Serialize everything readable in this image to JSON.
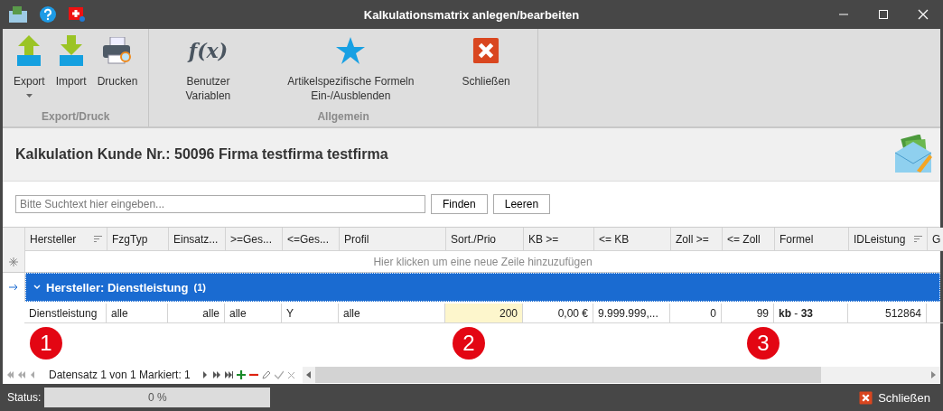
{
  "window": {
    "title": "Kalkulationsmatrix anlegen/bearbeiten"
  },
  "ribbon": {
    "groups": [
      {
        "label": "Export/Druck",
        "buttons": [
          {
            "kind": "export",
            "label": "Export",
            "dropdown": true
          },
          {
            "kind": "import",
            "label": "Import",
            "dropdown": false
          },
          {
            "kind": "print",
            "label": "Drucken",
            "dropdown": false
          }
        ]
      },
      {
        "label": "Allgemein",
        "buttons": [
          {
            "kind": "formula",
            "label": "Benutzer Variablen",
            "icon_text": "f(x)",
            "dropdown": false
          },
          {
            "kind": "star",
            "label": "Artikelspezifische Formeln Ein-/Ausblenden",
            "dropdown": false
          },
          {
            "kind": "close",
            "label": "Schließen",
            "dropdown": false
          }
        ]
      }
    ]
  },
  "header": {
    "title": "Kalkulation Kunde Nr.: 50096 Firma testfirma testfirma"
  },
  "search": {
    "placeholder": "Bitte Suchtext hier eingeben...",
    "buttons": [
      "Finden",
      "Leeren"
    ]
  },
  "grid": {
    "columns": [
      {
        "label": "Hersteller",
        "sorted": true,
        "kind": "text"
      },
      {
        "label": "FzgTyp",
        "sorted": false,
        "kind": "text"
      },
      {
        "label": "Einsatz...",
        "sorted": false,
        "kind": "number"
      },
      {
        "label": ">=Ges...",
        "sorted": false,
        "kind": "text"
      },
      {
        "label": "<=Ges...",
        "sorted": false,
        "kind": "text"
      },
      {
        "label": "Profil",
        "sorted": false,
        "kind": "text"
      },
      {
        "label": "Sort./Prio",
        "sorted": false,
        "kind": "number"
      },
      {
        "label": "KB >=",
        "sorted": false,
        "kind": "number"
      },
      {
        "label": "<= KB",
        "sorted": false,
        "kind": "text"
      },
      {
        "label": "Zoll >=",
        "sorted": false,
        "kind": "number"
      },
      {
        "label": "<= Zoll",
        "sorted": false,
        "kind": "number"
      },
      {
        "label": "Formel",
        "sorted": false,
        "kind": "text"
      },
      {
        "label": "IDLeistung",
        "sorted": true,
        "kind": "number"
      },
      {
        "label": "G",
        "sorted": false,
        "kind": "text"
      }
    ],
    "new_row_hint": "Hier klicken um eine neue Zeile hinzuzufügen",
    "group": {
      "label": "Hersteller: Dienstleistung",
      "count": "(1)",
      "expanded": true
    },
    "rows": [
      {
        "cells": [
          {
            "text": "Dienstleistung",
            "focused": false
          },
          {
            "text": "alle",
            "focused": false
          },
          {
            "text": "alle",
            "focused": false
          },
          {
            "text": "alle",
            "focused": false
          },
          {
            "text": "Y",
            "focused": false
          },
          {
            "text": "alle",
            "focused": false
          },
          {
            "text": "200",
            "focused": true
          },
          {
            "text": "0,00 €",
            "focused": false
          },
          {
            "text": "9.999.999,...",
            "focused": false
          },
          {
            "text": "0",
            "focused": false
          },
          {
            "text": "99",
            "focused": false
          },
          {
            "text": "**kb** - **33**",
            "focused": false
          },
          {
            "text": "512864",
            "focused": false
          },
          {
            "text": "",
            "focused": false
          }
        ]
      }
    ],
    "navigator": {
      "text": "Datensatz 1 von 1 Markiert: 1"
    }
  },
  "markers": [
    "1",
    "2",
    "3"
  ],
  "status_bar": {
    "label": "Status:",
    "progress": {
      "level": 0,
      "text": "0 %"
    },
    "close_label": "Schließen"
  }
}
